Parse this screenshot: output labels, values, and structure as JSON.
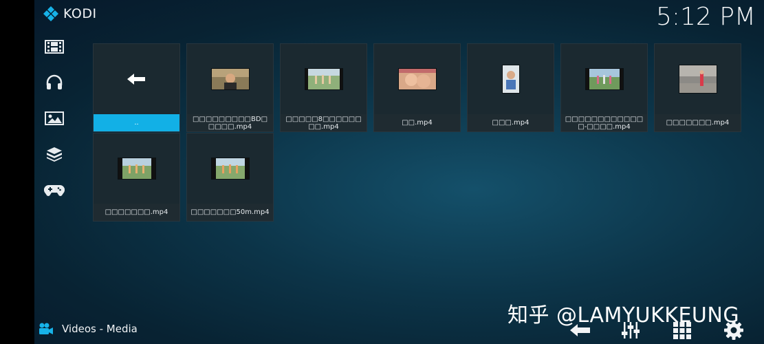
{
  "app": {
    "name": "KODI"
  },
  "clock": "5:12 PM",
  "sidebar": {
    "items": [
      {
        "icon": "film-icon"
      },
      {
        "icon": "headphones-icon"
      },
      {
        "icon": "picture-icon"
      },
      {
        "icon": "addons-box-icon"
      },
      {
        "icon": "gamepad-icon"
      }
    ]
  },
  "files": [
    {
      "label": ".."
    },
    {
      "label": "□□□□□□□□□BD□□□□□.mp4"
    },
    {
      "label": "□□□□□8□□□□□□□□.mp4"
    },
    {
      "label": "□□.mp4"
    },
    {
      "label": "□□□.mp4"
    },
    {
      "label": "□□□□□□□□□□□□□-□□□□.mp4"
    },
    {
      "label": "□□□□□□□.mp4"
    },
    {
      "label": "□□□□□□□.mp4"
    },
    {
      "label": "□□□□□□□50m.mp4"
    }
  ],
  "footer": {
    "section": "Videos - Media",
    "watermark": "知乎 @LAMYUKKEUNG",
    "colors": {
      "focus": "#12b0e6",
      "logo": "#17b2e8"
    }
  }
}
